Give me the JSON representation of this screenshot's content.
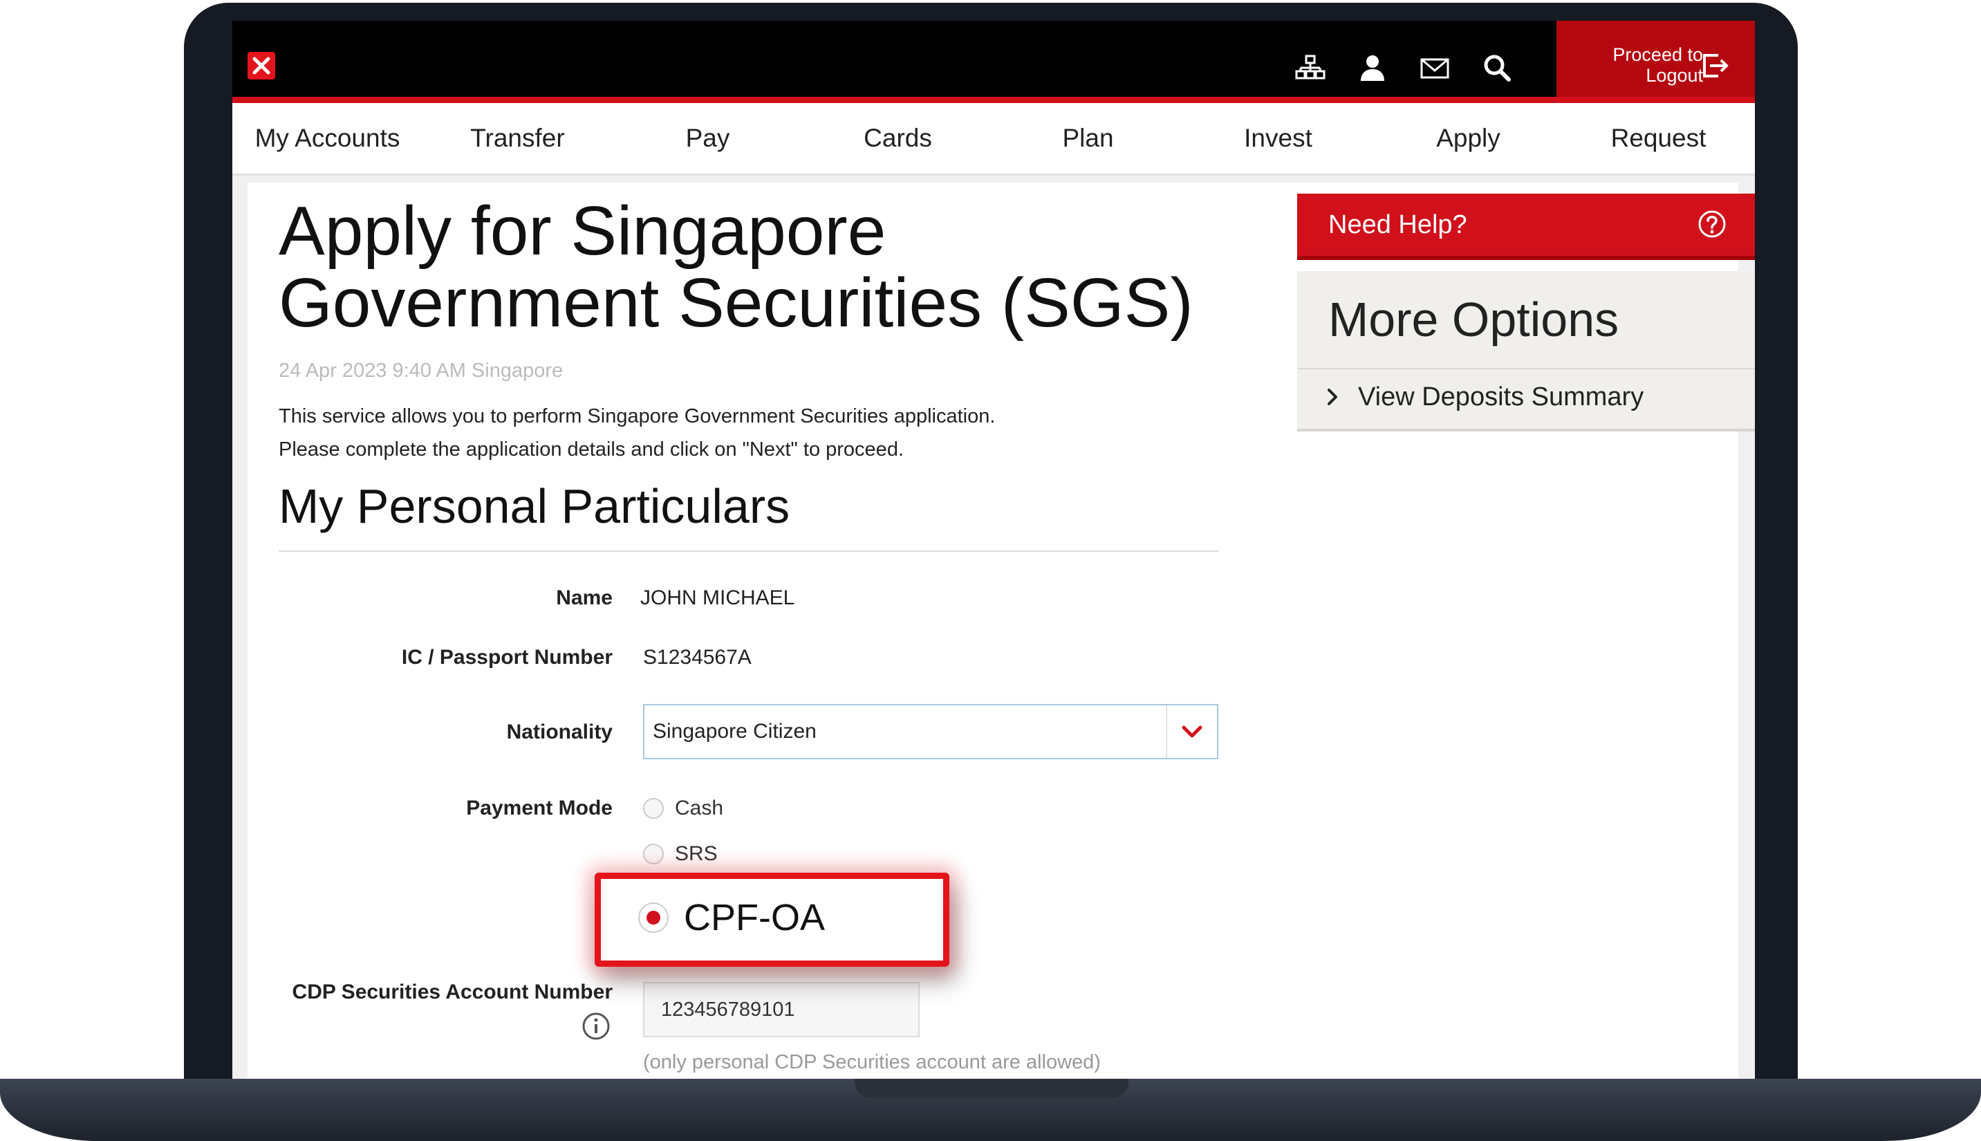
{
  "header": {
    "logout_label_line1": "Proceed to",
    "logout_label_line2": "Logout",
    "icons": [
      "sitemap-icon",
      "user-icon",
      "mail-icon",
      "search-icon",
      "logout-icon"
    ]
  },
  "nav": {
    "items": [
      {
        "label": "My Accounts"
      },
      {
        "label": "Transfer"
      },
      {
        "label": "Pay"
      },
      {
        "label": "Cards"
      },
      {
        "label": "Plan"
      },
      {
        "label": "Invest"
      },
      {
        "label": "Apply"
      },
      {
        "label": "Request"
      }
    ]
  },
  "page": {
    "title_line1": "Apply for Singapore",
    "title_line2": "Government Securities (SGS)",
    "timestamp": "24 Apr 2023 9:40 AM Singapore",
    "intro_line1": "This service allows you to perform Singapore Government Securities application.",
    "intro_line2": "Please complete the application details and click on \"Next\" to proceed."
  },
  "particulars": {
    "section_title": "My Personal Particulars",
    "name_label": "Name",
    "name_value": "JOHN MICHAEL",
    "ic_label": "IC / Passport Number",
    "ic_value": "S1234567A",
    "nationality_label": "Nationality",
    "nationality_value": "Singapore Citizen",
    "payment_label": "Payment Mode",
    "payment_options": [
      {
        "label": "Cash",
        "selected": false
      },
      {
        "label": "SRS",
        "selected": false
      },
      {
        "label": "CPF-OA",
        "selected": true
      }
    ],
    "cdp_label": "CDP Securities Account Number",
    "cdp_value": "123456789101",
    "cdp_hint": "(only personal CDP Securities account are allowed)"
  },
  "sidebar": {
    "help_label": "Need Help?",
    "options_title": "More Options",
    "links": [
      {
        "label": "View Deposits Summary"
      }
    ]
  },
  "colors": {
    "brand_red": "#d0101b",
    "header_black": "#000000"
  }
}
